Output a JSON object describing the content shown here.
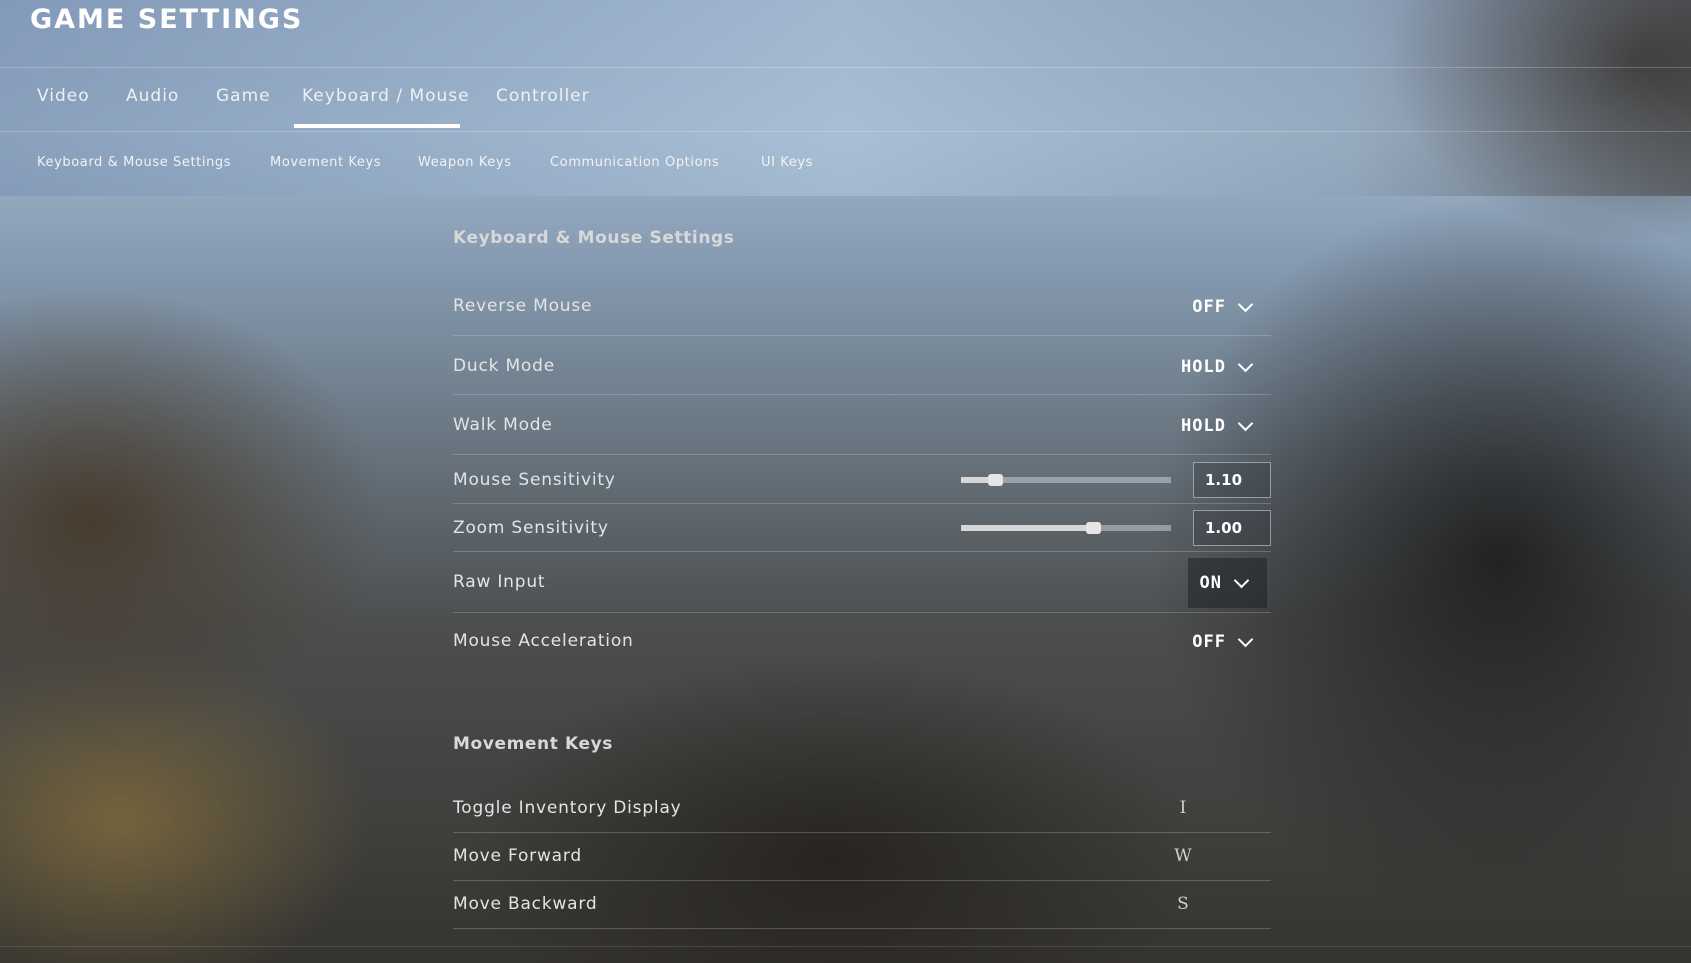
{
  "header": {
    "title": "GAME SETTINGS"
  },
  "tabs": [
    {
      "label": "Video"
    },
    {
      "label": "Audio"
    },
    {
      "label": "Game"
    },
    {
      "label": "Keyboard / Mouse",
      "active": true
    },
    {
      "label": "Controller"
    }
  ],
  "subtabs": [
    {
      "label": "Keyboard & Mouse Settings"
    },
    {
      "label": "Movement Keys"
    },
    {
      "label": "Weapon Keys"
    },
    {
      "label": "Communication Options"
    },
    {
      "label": "UI Keys"
    }
  ],
  "kbm_section": {
    "title": "Keyboard & Mouse Settings",
    "reverse_mouse": {
      "label": "Reverse Mouse",
      "value": "OFF"
    },
    "duck_mode": {
      "label": "Duck Mode",
      "value": "HOLD"
    },
    "walk_mode": {
      "label": "Walk Mode",
      "value": "HOLD"
    },
    "mouse_sensitivity": {
      "label": "Mouse Sensitivity",
      "value": "1.10",
      "slider_fraction": 0.16
    },
    "zoom_sensitivity": {
      "label": "Zoom Sensitivity",
      "value": "1.00",
      "slider_fraction": 0.63
    },
    "raw_input": {
      "label": "Raw Input",
      "value": "ON"
    },
    "mouse_acceleration": {
      "label": "Mouse Acceleration",
      "value": "OFF"
    }
  },
  "movement_section": {
    "title": "Movement Keys",
    "toggle_inventory": {
      "label": "Toggle Inventory Display",
      "key": "I"
    },
    "move_forward": {
      "label": "Move Forward",
      "key": "W"
    },
    "move_backward": {
      "label": "Move Backward",
      "key": "S"
    }
  },
  "colors": {
    "accent": "#ffffff",
    "text": "#e4e4e4"
  }
}
